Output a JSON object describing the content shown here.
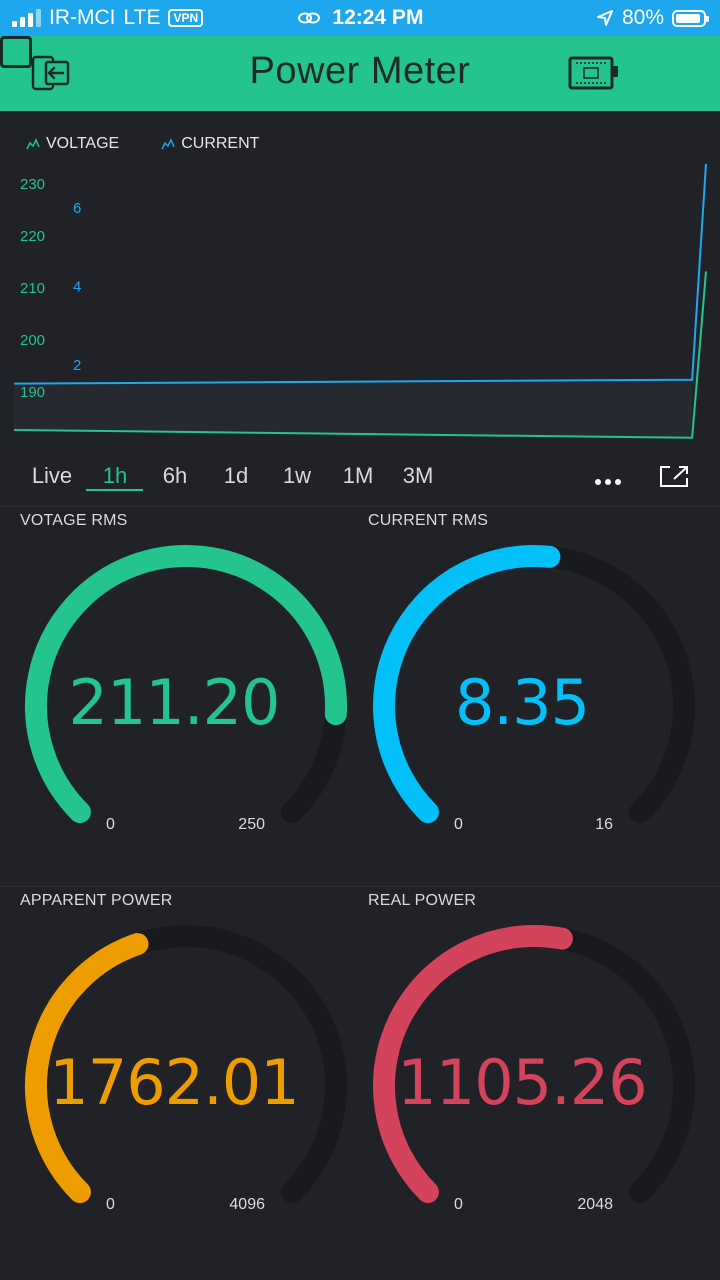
{
  "status_bar": {
    "carrier": "IR-MCI",
    "network": "LTE",
    "vpn": "VPN",
    "time": "12:24 PM",
    "battery": "80%"
  },
  "header": {
    "title": "Power Meter"
  },
  "chart": {
    "legend": [
      "VOLTAGE",
      "CURRENT"
    ],
    "tabs": [
      "Live",
      "1h",
      "6h",
      "1d",
      "1w",
      "1M",
      "3M"
    ],
    "active_tab": "1h"
  },
  "chart_data": {
    "type": "line",
    "series": [
      {
        "name": "VOLTAGE",
        "color": "#23c48e",
        "axis": "left",
        "points": [
          [
            0,
            182.5
          ],
          [
            0.98,
            181.0
          ],
          [
            1.0,
            213.0
          ]
        ]
      },
      {
        "name": "CURRENT",
        "color": "#1fa7ee",
        "axis": "right",
        "points": [
          [
            0,
            1.5
          ],
          [
            0.98,
            1.6
          ],
          [
            1.0,
            7.1
          ]
        ]
      }
    ],
    "left_axis": {
      "ticks": [
        190,
        200,
        210,
        220,
        230
      ],
      "color": "#23c48e"
    },
    "right_axis": {
      "ticks": [
        2,
        4,
        6
      ],
      "color": "#1fa7ee"
    }
  },
  "gauges": [
    {
      "label": "VOTAGE RMS",
      "value": "211.20",
      "num": 211.2,
      "min": "0",
      "max": "250",
      "min_num": 0,
      "max_num": 250,
      "color": "#23c48e"
    },
    {
      "label": "CURRENT RMS",
      "value": "8.35",
      "num": 8.35,
      "min": "0",
      "max": "16",
      "min_num": 0,
      "max_num": 16,
      "color": "#04c0f8"
    },
    {
      "label": "APPARENT POWER",
      "value": "1762.01",
      "num": 1762.01,
      "min": "0",
      "max": "4096",
      "min_num": 0,
      "max_num": 4096,
      "color": "#ed9d00"
    },
    {
      "label": "REAL POWER",
      "value": "1105.26",
      "num": 1105.26,
      "min": "0",
      "max": "2048",
      "min_num": 0,
      "max_num": 2048,
      "color": "#d3435c"
    }
  ]
}
